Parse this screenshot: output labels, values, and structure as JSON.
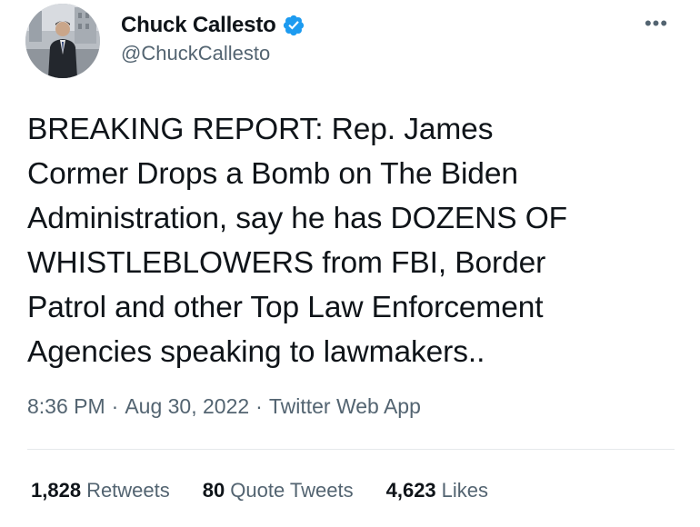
{
  "author": {
    "display_name": "Chuck Callesto",
    "handle": "@ChuckCallesto",
    "verified": true,
    "verified_color": "#1d9bf0"
  },
  "tweet": {
    "text": "BREAKING REPORT: Rep. James\nCormer Drops a Bomb on The Biden\nAdministration, say he has DOZENS OF\nWHISTLEBLOWERS from FBI, Border\nPatrol and other Top Law Enforcement\nAgencies speaking to lawmakers..",
    "time": "8:36 PM",
    "date": "Aug 30, 2022",
    "source": "Twitter Web App",
    "separator": "·"
  },
  "stats": {
    "retweets_count": "1,828",
    "retweets_label": "Retweets",
    "quote_count": "80",
    "quote_label": "Quote Tweets",
    "likes_count": "4,623",
    "likes_label": "Likes"
  },
  "icons": {
    "more": "more-horizontal-icon",
    "more_glyph": "•••",
    "verified": "verified-badge-icon"
  }
}
